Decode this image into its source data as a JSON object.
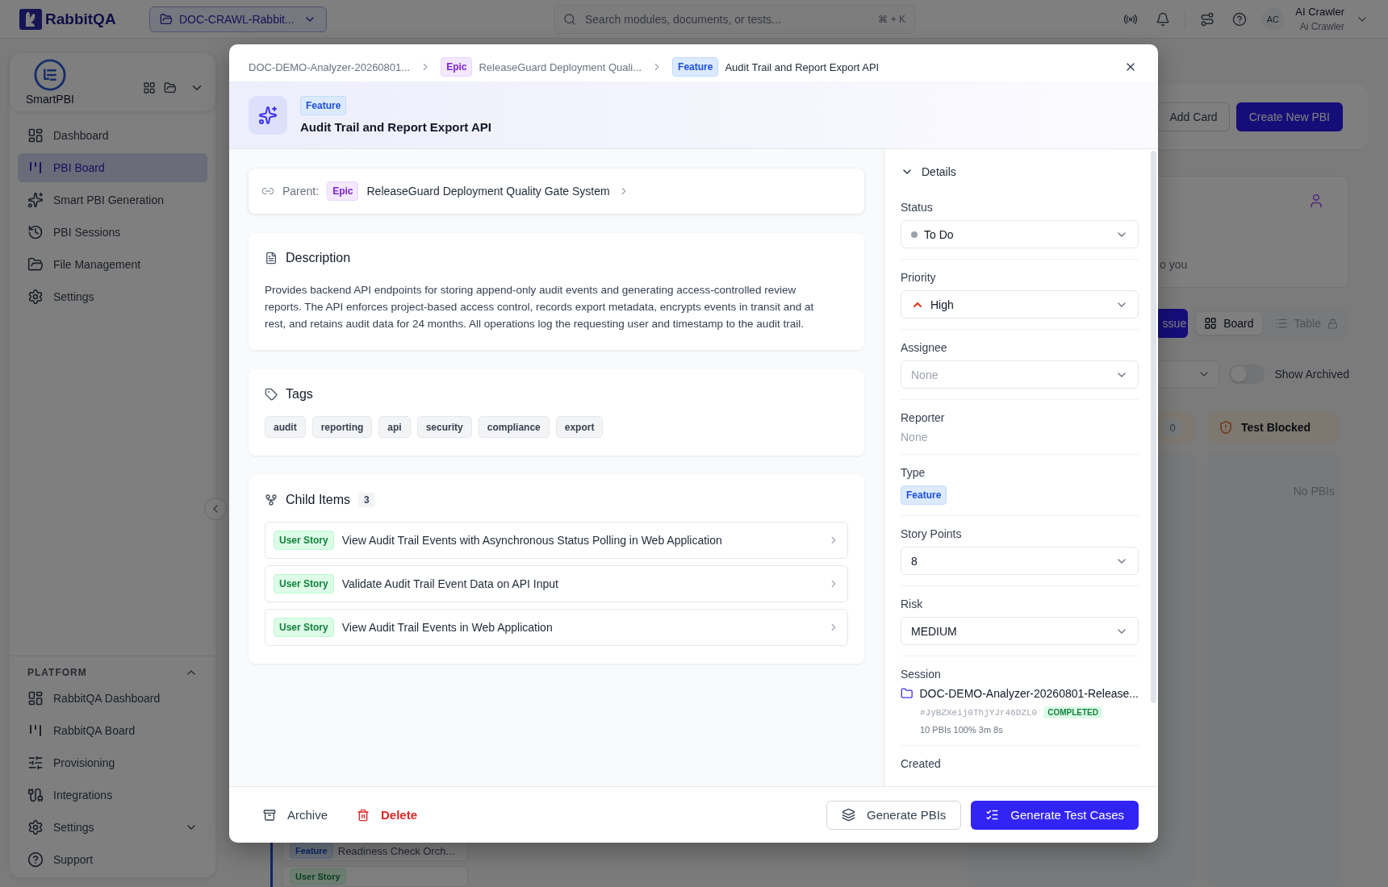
{
  "topbar": {
    "brand": "RabbitQA",
    "project": "DOC-CRAWL-Rabbit...",
    "search_placeholder": "Search modules, documents, or tests...",
    "shortcut": "⌘ + K",
    "avatar": "AC",
    "user_name": "AI Crawler",
    "user_role": "Ai Crawler"
  },
  "sidebar": {
    "app_name": "SmartPBI",
    "items": [
      {
        "label": "Dashboard",
        "selected": false
      },
      {
        "label": "PBI Board",
        "selected": true
      },
      {
        "label": "Smart PBI Generation",
        "selected": false
      },
      {
        "label": "PBI Sessions",
        "selected": false
      },
      {
        "label": "File Management",
        "selected": false
      },
      {
        "label": "Settings",
        "selected": false
      }
    ],
    "platform": {
      "title": "PLATFORM",
      "expanded": true,
      "items": [
        {
          "label": "RabbitQA Dashboard",
          "selected": false,
          "submenu": false
        },
        {
          "label": "RabbitQA Board",
          "selected": false,
          "submenu": false
        },
        {
          "label": "Provisioning",
          "selected": false,
          "submenu": false
        },
        {
          "label": "Integrations",
          "selected": false,
          "submenu": false
        },
        {
          "label": "Settings",
          "selected": false,
          "submenu": true
        },
        {
          "label": "Support",
          "selected": false,
          "submenu": false
        }
      ]
    }
  },
  "board": {
    "add_card": "Add Card",
    "create": "Create New PBI",
    "summary_text": "o you",
    "issue_button": "ssue",
    "views": [
      {
        "label": "Board",
        "selected": true,
        "locked": false
      },
      {
        "label": "Table",
        "selected": false,
        "locked": true
      }
    ],
    "show_archived": {
      "label": "Show Archived",
      "on": false
    },
    "columns": [
      {
        "cards": [
          {
            "kind": "feature",
            "badge": "Feature",
            "title": "Readiness Check Orch..."
          },
          {
            "kind": "story",
            "badge": "User Story"
          }
        ]
      },
      {
        "count": "0"
      },
      {
        "title": "Test Blocked",
        "empty": "No PBIs"
      }
    ]
  },
  "modal": {
    "breadcrumbs": [
      {
        "text": "DOC-DEMO-Analyzer-20260801..."
      },
      {
        "badge": "Epic",
        "kind": "epic",
        "text": "ReleaseGuard Deployment Quali..."
      },
      {
        "badge": "Feature",
        "kind": "feature",
        "text": "Audit Trail and Report Export API"
      }
    ],
    "header": {
      "badge": "Feature",
      "kind": "feature",
      "title": "Audit Trail and Report Export API"
    },
    "parent": {
      "label": "Parent:",
      "badge": "Epic",
      "kind": "epic",
      "title": "ReleaseGuard Deployment Quality Gate System"
    },
    "description": {
      "title": "Description",
      "text": "Provides backend API endpoints for storing append-only audit events and generating access-controlled review reports. The API enforces project-based access control, records export metadata, encrypts events in transit and at rest, and retains audit data for 24 months. All operations log the requesting user and timestamp to the audit trail."
    },
    "tags": {
      "title": "Tags",
      "items": [
        "audit",
        "reporting",
        "api",
        "security",
        "compliance",
        "export"
      ]
    },
    "child_items": {
      "title": "Child Items",
      "count": "3",
      "items": [
        {
          "badge": "User Story",
          "kind": "story",
          "title": "View Audit Trail Events with Asynchronous Status Polling in Web Application"
        },
        {
          "badge": "User Story",
          "kind": "story",
          "title": "Validate Audit Trail Event Data on API Input"
        },
        {
          "badge": "User Story",
          "kind": "story",
          "title": "View Audit Trail Events in Web Application"
        }
      ]
    },
    "details": {
      "title": "Details",
      "expanded": true,
      "fields": [
        {
          "kind": "status",
          "label": "Status",
          "value": "To Do"
        },
        {
          "kind": "priority",
          "label": "Priority",
          "value": "High"
        },
        {
          "kind": "select",
          "label": "Assignee",
          "placeholder": "None"
        },
        {
          "kind": "text",
          "label": "Reporter",
          "placeholder": "None"
        },
        {
          "kind": "badge",
          "label": "Type",
          "value": "Feature"
        },
        {
          "kind": "select",
          "label": "Story Points",
          "value": "8"
        },
        {
          "kind": "select",
          "label": "Risk",
          "value": "MEDIUM"
        },
        {
          "kind": "session",
          "label": "Session",
          "value": "DOC-DEMO-Analyzer-20260801-Release...",
          "id": "#JyBZXeij0ThjYJr46DZL0",
          "status": "COMPLETED",
          "meta": "10 PBIs 100% 3m 8s"
        },
        {
          "kind": "label",
          "label": "Created"
        }
      ]
    },
    "footer": {
      "archive": "Archive",
      "delete": "Delete",
      "generate_pbis": "Generate PBIs",
      "generate_tests": "Generate Test Cases"
    }
  }
}
